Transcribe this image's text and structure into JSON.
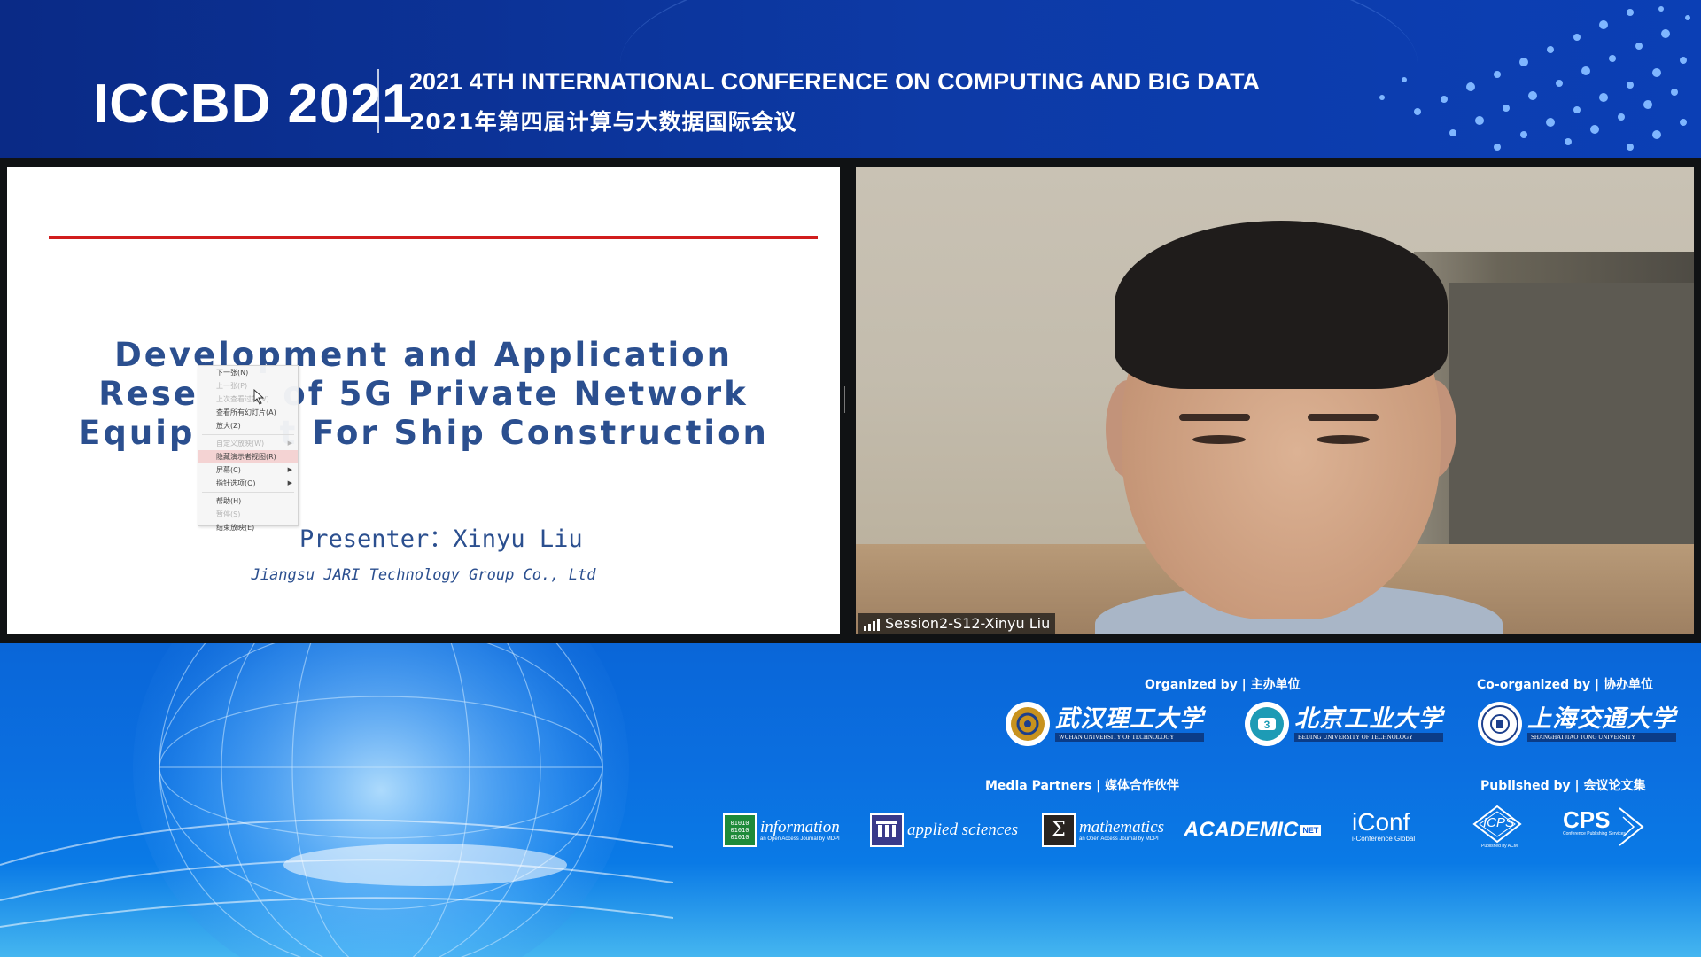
{
  "header": {
    "brand": "ICCBD 2021",
    "conference_en": "2021 4TH INTERNATIONAL CONFERENCE ON COMPUTING AND BIG DATA",
    "conference_cn": "2021年第四届计算与大数据国际会议"
  },
  "slide": {
    "title_lines": [
      "Development and Application",
      "Rese      of 5G Private Network",
      "Equip      t For Ship Construction"
    ],
    "presenter": "Presenter：Xinyu Liu",
    "company": "Jiangsu JARI Technology Group Co., Ltd",
    "context_menu": [
      {
        "label": "下一张(N)",
        "disabled": false
      },
      {
        "label": "上一张(P)",
        "disabled": true
      },
      {
        "label": "上次查看过的(V)",
        "disabled": true
      },
      {
        "label": "查看所有幻灯片(A)",
        "disabled": false
      },
      {
        "label": "放大(Z)",
        "disabled": false
      },
      {
        "label": "自定义放映(W)",
        "disabled": true
      },
      {
        "label": "隐藏演示者视图(R)",
        "disabled": false
      },
      {
        "label": "屏幕(C)",
        "disabled": false
      },
      {
        "label": "指针选项(O)",
        "disabled": false
      },
      {
        "label": "帮助(H)",
        "disabled": false
      },
      {
        "label": "暂停(S)",
        "disabled": true
      },
      {
        "label": "结束放映(E)",
        "disabled": false
      }
    ]
  },
  "video": {
    "participant_name": "Session2-S12-Xinyu Liu"
  },
  "footer": {
    "organized_by": "Organized by | 主办单位",
    "co_organized_by": "Co-organized by | 协办单位",
    "media_partners": "Media Partners | 媒体合作伙伴",
    "published_by": "Published by | 会议论文集",
    "organizers": [
      {
        "cn": "武汉理工大学",
        "en": "WUHAN UNIVERSITY OF TECHNOLOGY"
      },
      {
        "cn": "北京工业大学",
        "en": "BEIJING UNIVERSITY OF TECHNOLOGY"
      }
    ],
    "co_organizers": [
      {
        "cn": "上海交通大学",
        "en": "SHANGHAI JIAO TONG UNIVERSITY"
      }
    ],
    "media": [
      {
        "name": "information",
        "sub": "an Open Access Journal by MDPI",
        "icon_text": "01010"
      },
      {
        "name": "applied sciences",
        "sub": ""
      },
      {
        "name": "mathematics",
        "sub": "an Open Access Journal by MDPI",
        "icon_text": "Σ"
      },
      {
        "name": "ACADEMIC",
        "badge": "NET"
      },
      {
        "name": "iConf",
        "sub": "i-Conference Global"
      }
    ],
    "publishers": [
      {
        "name": "ICPS",
        "sub": "Published by ACM"
      },
      {
        "name": "CPS",
        "sub": "Conference Publishing Services"
      }
    ]
  }
}
